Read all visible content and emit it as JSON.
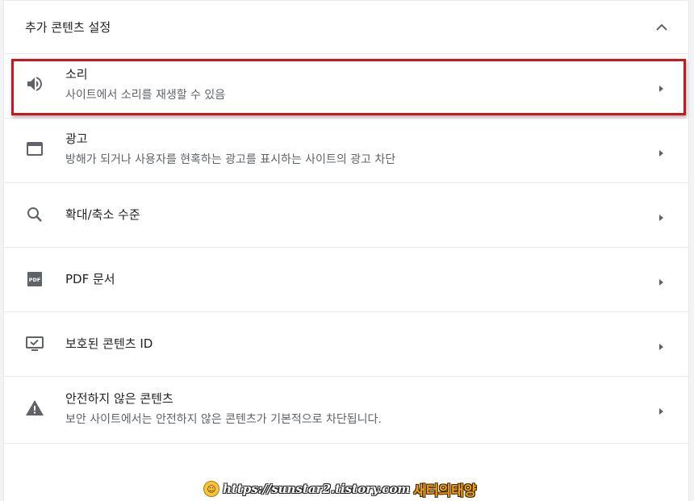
{
  "section": {
    "title": "추가 콘텐츠 설정",
    "collapse_icon": "chevron-up-icon"
  },
  "items": [
    {
      "title": "소리",
      "subtitle": "사이트에서 소리를 재생할 수 있음",
      "icon": "volume-icon"
    },
    {
      "title": "광고",
      "subtitle": "방해가 되거나 사용자를 현혹하는 광고를 표시하는 사이트의 광고 차단",
      "icon": "browser-window-icon"
    },
    {
      "title": "확대/축소 수준",
      "subtitle": "",
      "icon": "search-icon"
    },
    {
      "title": "PDF 문서",
      "subtitle": "",
      "icon": "pdf-icon"
    },
    {
      "title": "보호된 콘텐츠 ID",
      "subtitle": "",
      "icon": "monitor-check-icon"
    },
    {
      "title": "안전하지 않은 콘텐츠",
      "subtitle": "보안 사이트에서는 안전하지 않은 콘텐츠가 기본적으로 차단됩니다.",
      "icon": "warning-icon"
    }
  ],
  "watermark": {
    "url": "https://sunstar2.tistory.com",
    "name": "새터의태양"
  },
  "colors": {
    "highlight_border": "#c8161d",
    "icon": "#5f6368",
    "text_primary": "#202124",
    "text_secondary": "#5f6368"
  }
}
